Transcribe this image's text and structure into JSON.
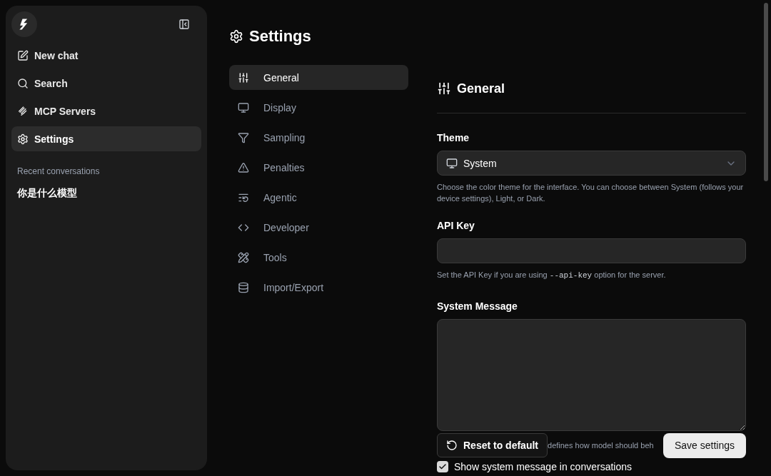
{
  "sidebar": {
    "items": [
      {
        "label": "New chat",
        "selected": false
      },
      {
        "label": "Search",
        "selected": false
      },
      {
        "label": "MCP Servers",
        "selected": false
      },
      {
        "label": "Settings",
        "selected": true
      }
    ],
    "section_title": "Recent conversations",
    "conversations": [
      "你是什么模型"
    ]
  },
  "page_title": "Settings",
  "nav": [
    {
      "label": "General",
      "selected": true
    },
    {
      "label": "Display",
      "selected": false
    },
    {
      "label": "Sampling",
      "selected": false
    },
    {
      "label": "Penalties",
      "selected": false
    },
    {
      "label": "Agentic",
      "selected": false
    },
    {
      "label": "Developer",
      "selected": false
    },
    {
      "label": "Tools",
      "selected": false
    },
    {
      "label": "Import/Export",
      "selected": false
    }
  ],
  "section": {
    "title": "General",
    "theme": {
      "label": "Theme",
      "value": "System",
      "help": "Choose the color theme for the interface. You can choose between System (follows your device settings), Light, or Dark."
    },
    "api_key": {
      "label": "API Key",
      "help_before": "Set the API Key if you are using",
      "help_code": "--api-key",
      "help_after": "option for the server."
    },
    "system_message": {
      "label": "System Message",
      "help_visible": "defines how model should beh"
    },
    "show_system_message": {
      "label": "Show system message in conversations",
      "checked": true
    }
  },
  "buttons": {
    "reset": "Reset to default",
    "save": "Save settings"
  }
}
